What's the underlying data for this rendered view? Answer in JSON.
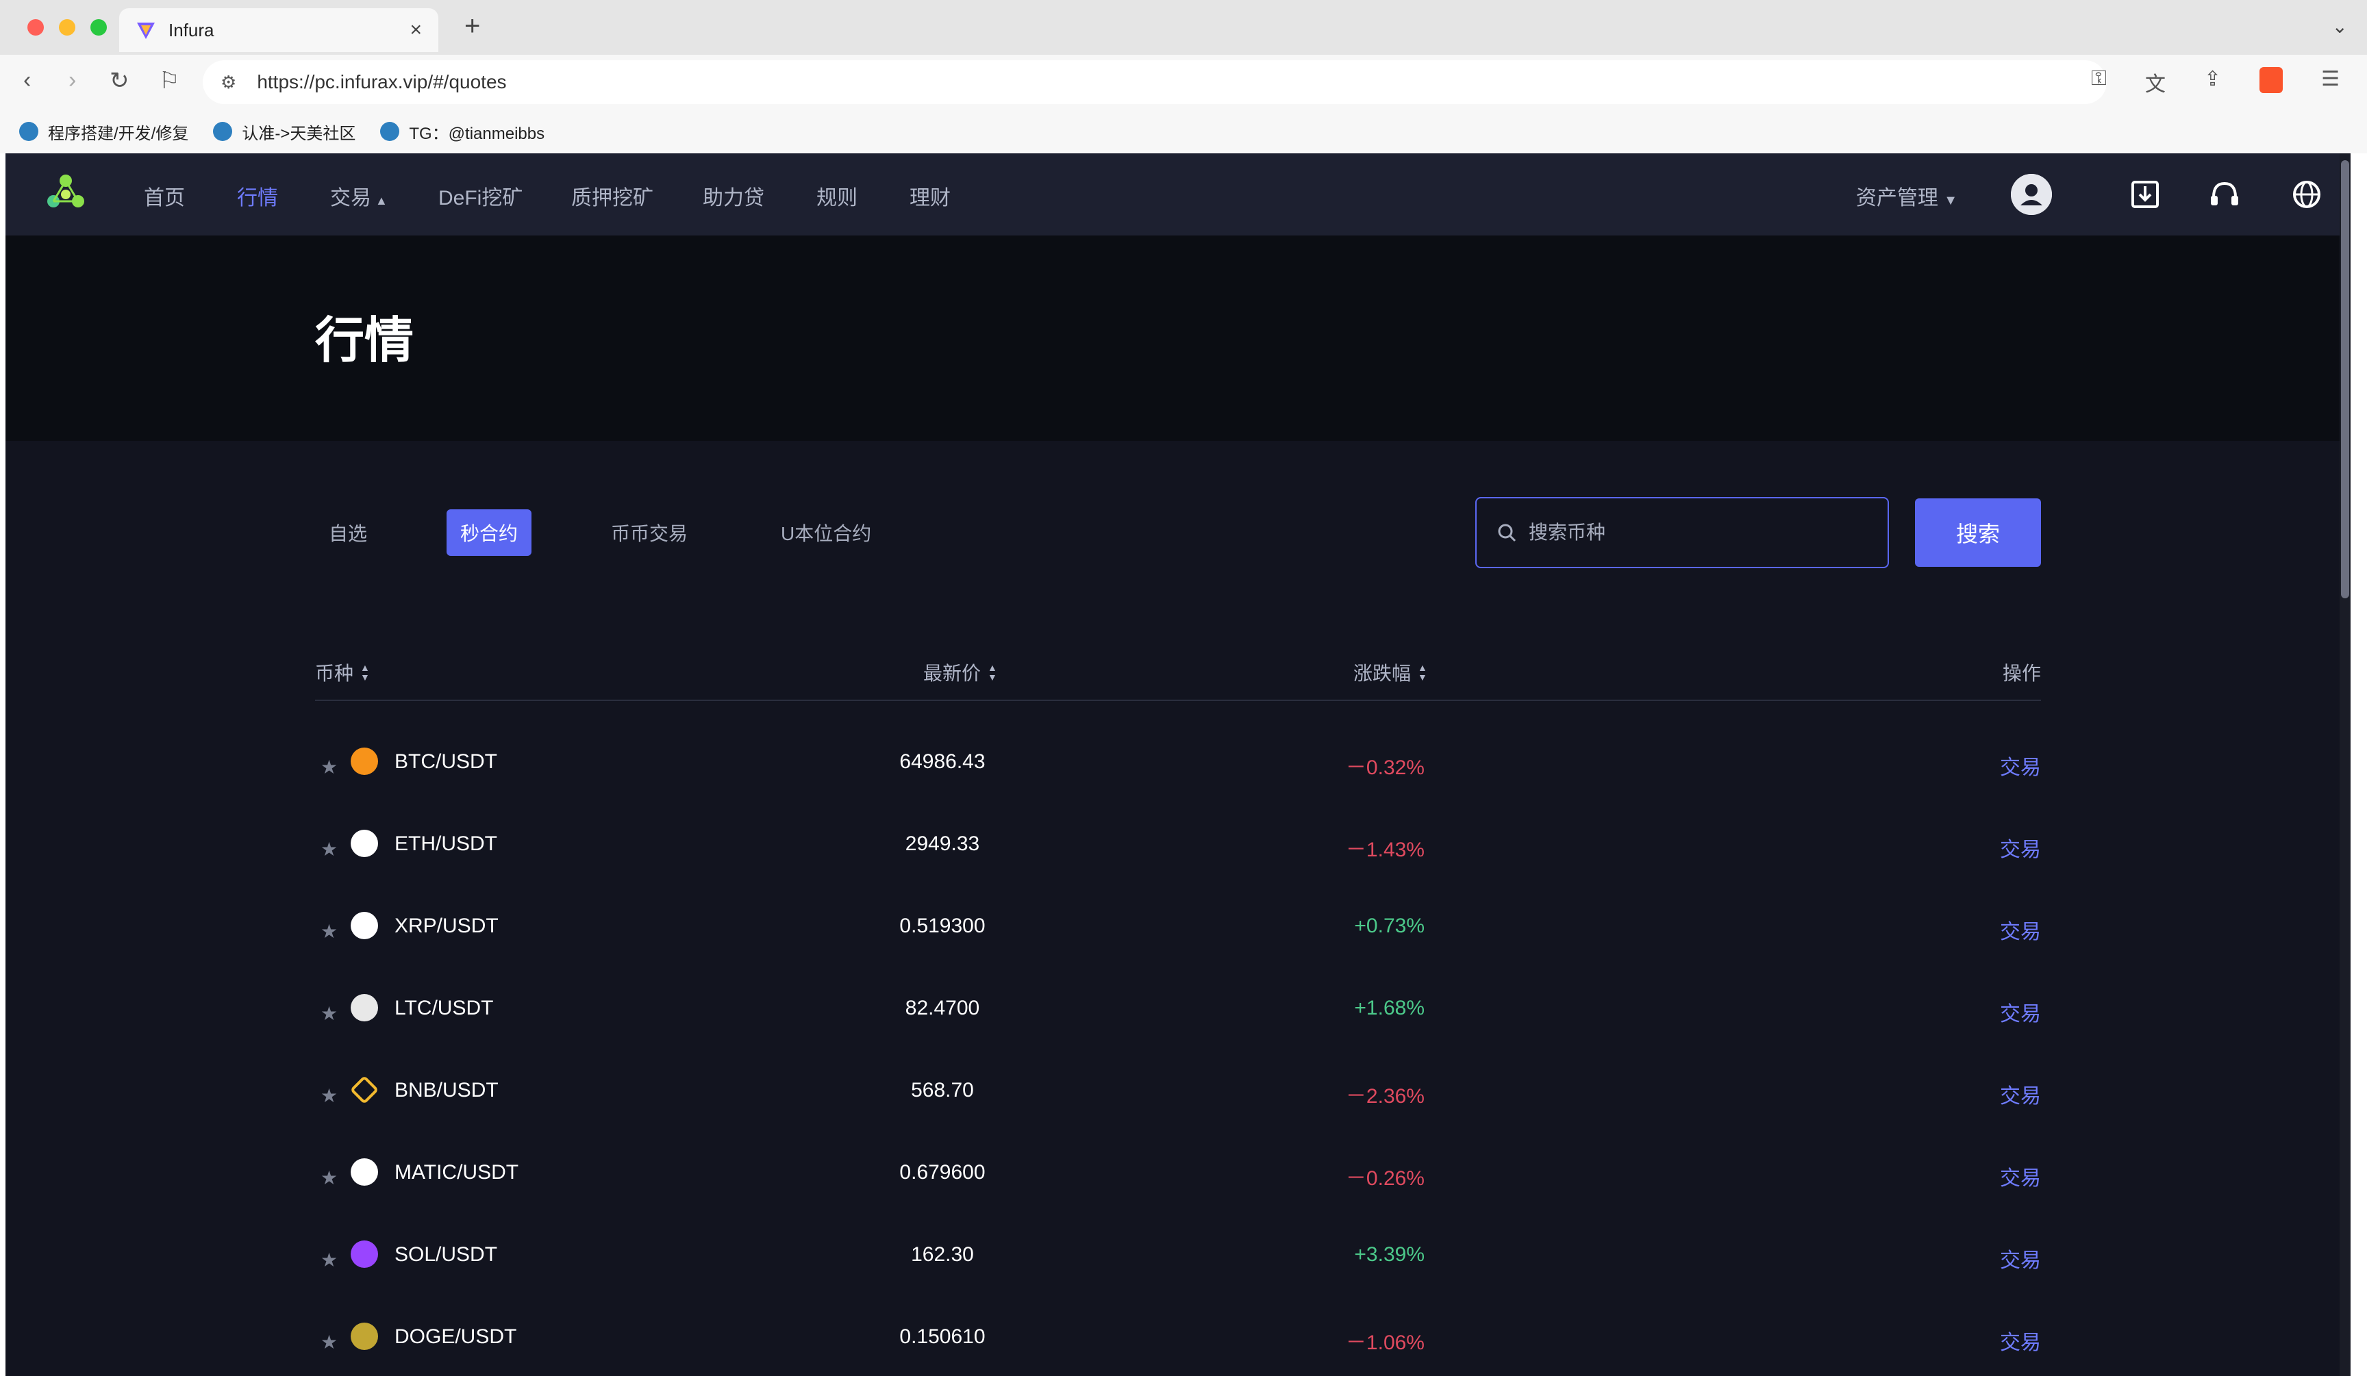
{
  "browser": {
    "tab_title": "Infura",
    "url": "https://pc.infurax.vip/#/quotes",
    "bookmarks": [
      {
        "label": "程序搭建/开发/修复"
      },
      {
        "label": "认准->天美社区"
      },
      {
        "label": "TG：@tianmeibbs"
      }
    ]
  },
  "site": {
    "nav": [
      {
        "label": "首页"
      },
      {
        "label": "行情"
      },
      {
        "label": "交易"
      },
      {
        "label": "DeFi挖矿"
      },
      {
        "label": "质押挖矿"
      },
      {
        "label": "助力贷"
      },
      {
        "label": "规则"
      },
      {
        "label": "理财"
      }
    ],
    "asset_menu": "资产管理",
    "page_title": "行情",
    "tabs": [
      {
        "label": "自选"
      },
      {
        "label": "秒合约"
      },
      {
        "label": "币币交易"
      },
      {
        "label": "U本位合约"
      }
    ],
    "search_placeholder": "搜索币种",
    "search_button": "搜索",
    "table": {
      "headers": [
        "币种",
        "最新价",
        "涨跌幅",
        "操作"
      ],
      "rows": [
        {
          "pair": "BTC/USDT",
          "price": "64986.43",
          "change": "－0.32%",
          "direction": "down",
          "action": "交易"
        },
        {
          "pair": "ETH/USDT",
          "price": "2949.33",
          "change": "－1.43%",
          "direction": "down",
          "action": "交易"
        },
        {
          "pair": "XRP/USDT",
          "price": "0.519300",
          "change": "+0.73%",
          "direction": "up",
          "action": "交易"
        },
        {
          "pair": "LTC/USDT",
          "price": "82.4700",
          "change": "+1.68%",
          "direction": "up",
          "action": "交易"
        },
        {
          "pair": "BNB/USDT",
          "price": "568.70",
          "change": "－2.36%",
          "direction": "down",
          "action": "交易"
        },
        {
          "pair": "MATIC/USDT",
          "price": "0.679600",
          "change": "－0.26%",
          "direction": "down",
          "action": "交易"
        },
        {
          "pair": "SOL/USDT",
          "price": "162.30",
          "change": "+3.39%",
          "direction": "up",
          "action": "交易"
        },
        {
          "pair": "DOGE/USDT",
          "price": "0.150610",
          "change": "－1.06%",
          "direction": "down",
          "action": "交易"
        }
      ]
    }
  },
  "colors": {
    "accent": "#5a67f2",
    "up": "#4cc98a",
    "down": "#e04a5f"
  },
  "icons": {
    "coins": [
      "btc-icon",
      "eth-icon",
      "xrp-icon",
      "ltc-icon",
      "bnb-icon",
      "matic-icon",
      "sol-icon",
      "doge-icon"
    ]
  }
}
